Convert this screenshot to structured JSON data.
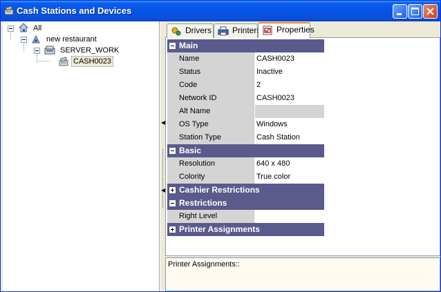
{
  "window": {
    "title": "Cash Stations and Devices"
  },
  "tree": {
    "nodes": [
      {
        "label": "All",
        "icon": "house-icon"
      },
      {
        "label": "new restaurant",
        "icon": "restaurant-icon"
      },
      {
        "label": "SERVER_WORK",
        "icon": "server-icon"
      },
      {
        "label": "CASH0023",
        "icon": "cash-station-icon",
        "selected": true
      }
    ]
  },
  "tabs": [
    {
      "label": "Drivers",
      "icon": "drivers-icon"
    },
    {
      "label": "Printers",
      "icon": "printer-icon"
    },
    {
      "label": "Properties",
      "icon": "properties-icon",
      "active": true
    }
  ],
  "properties": {
    "main": {
      "label": "Main",
      "rows": [
        {
          "name": "Name",
          "value": "CASH0023"
        },
        {
          "name": "Status",
          "value": "Inactive"
        },
        {
          "name": "Code",
          "value": "2"
        },
        {
          "name": "Network ID",
          "value": "CASH0023"
        },
        {
          "name": "Alt Name",
          "value": ""
        },
        {
          "name": "OS Type",
          "value": "Windows"
        },
        {
          "name": "Station Type",
          "value": "Cash Station"
        }
      ]
    },
    "basic": {
      "label": "Basic",
      "rows": [
        {
          "name": "Resolution",
          "value": "640 x 480"
        },
        {
          "name": "Colority",
          "value": "True color"
        }
      ]
    },
    "cashier_restrictions": {
      "label": "Cashier Restrictions"
    },
    "restrictions": {
      "label": "Restrictions",
      "rows": [
        {
          "name": "Right Level",
          "value": ""
        }
      ]
    },
    "printer_assignments": {
      "label": "Printer Assignments"
    }
  },
  "description": {
    "text": "Printer Assignments::"
  }
}
